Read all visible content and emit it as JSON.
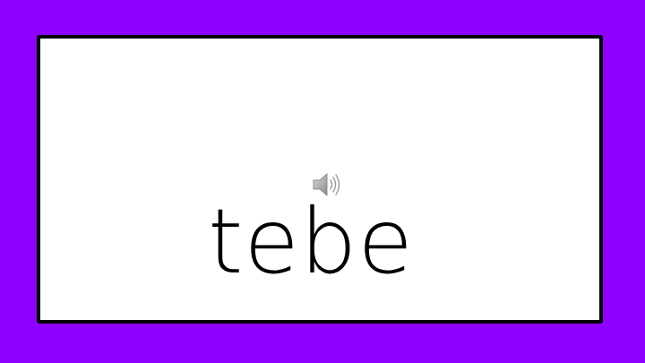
{
  "slide": {
    "word": "tebe",
    "audio_icon": "speaker-sound-icon"
  },
  "colors": {
    "background": "#8e00ff",
    "card": "#ffffff",
    "border": "#000000",
    "text": "#000000"
  }
}
